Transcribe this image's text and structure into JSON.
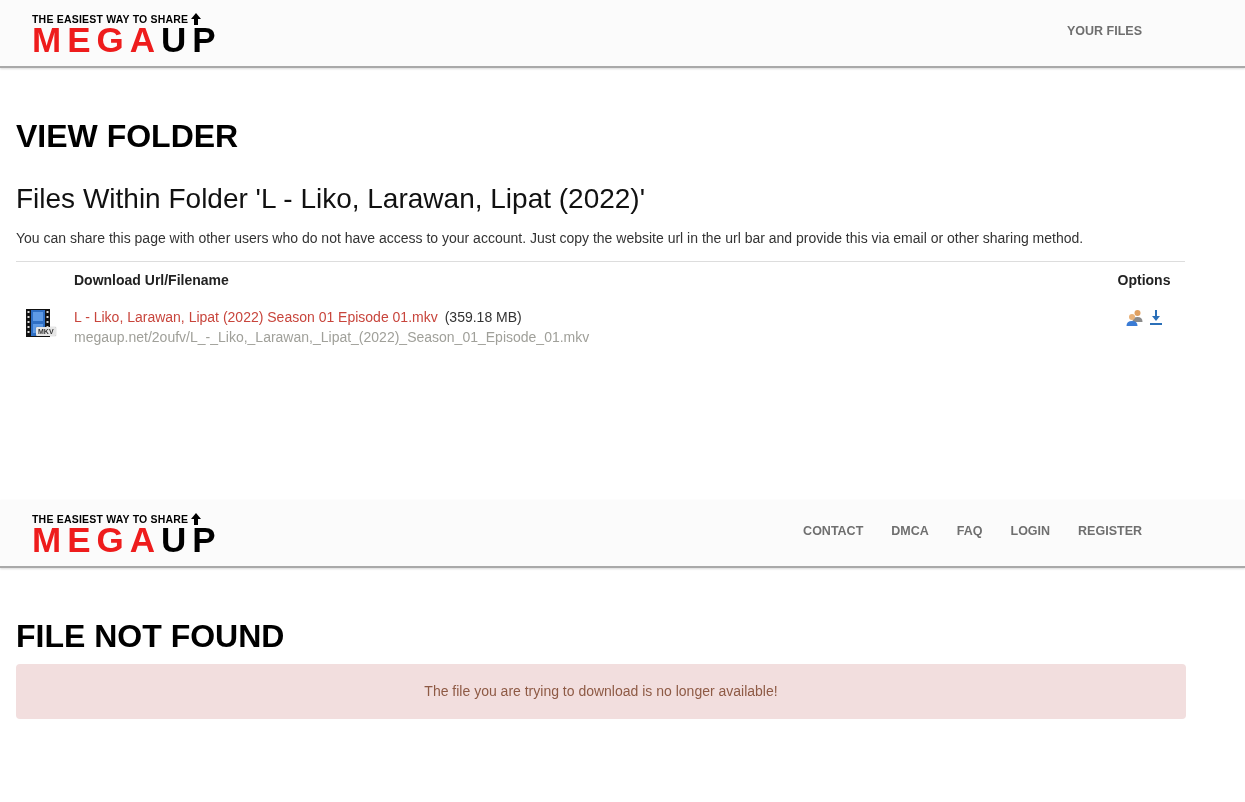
{
  "pages": [
    {
      "kind": "folder",
      "header": {
        "logo": {
          "tagline": "THE EASIEST WAY TO SHARE",
          "wordmark": [
            "MEGA",
            "UP"
          ]
        },
        "nav": [
          "YOUR FILES"
        ]
      },
      "title": "VIEW FOLDER",
      "subtitle": "Files Within Folder 'L - Liko, Larawan, Lipat (2022)'",
      "description": "You can share this page with other users who do not have access to your account. Just copy the website url in the url bar and provide this via email or other sharing method.",
      "table": {
        "columns": [
          "Download Url/Filename",
          "Options"
        ],
        "rows": [
          {
            "file_type": "MKV",
            "filename": "L - Liko, Larawan, Lipat (2022) Season 01 Episode 01.mkv",
            "size": "(359.18 MB)",
            "url": "megaup.net/2oufv/L_-_Liko,_Larawan,_Lipat_(2022)_Season_01_Episode_01.mkv"
          }
        ]
      }
    },
    {
      "kind": "notice",
      "header": {
        "logo": {
          "tagline": "THE EASIEST WAY TO SHARE",
          "wordmark": [
            "MEGA",
            "UP"
          ]
        },
        "nav": [
          "CONTACT",
          "DMCA",
          "FAQ",
          "LOGIN",
          "REGISTER"
        ]
      },
      "title": "FILE NOT FOUND",
      "alert": "The file you are trying to download is no longer available!"
    }
  ]
}
